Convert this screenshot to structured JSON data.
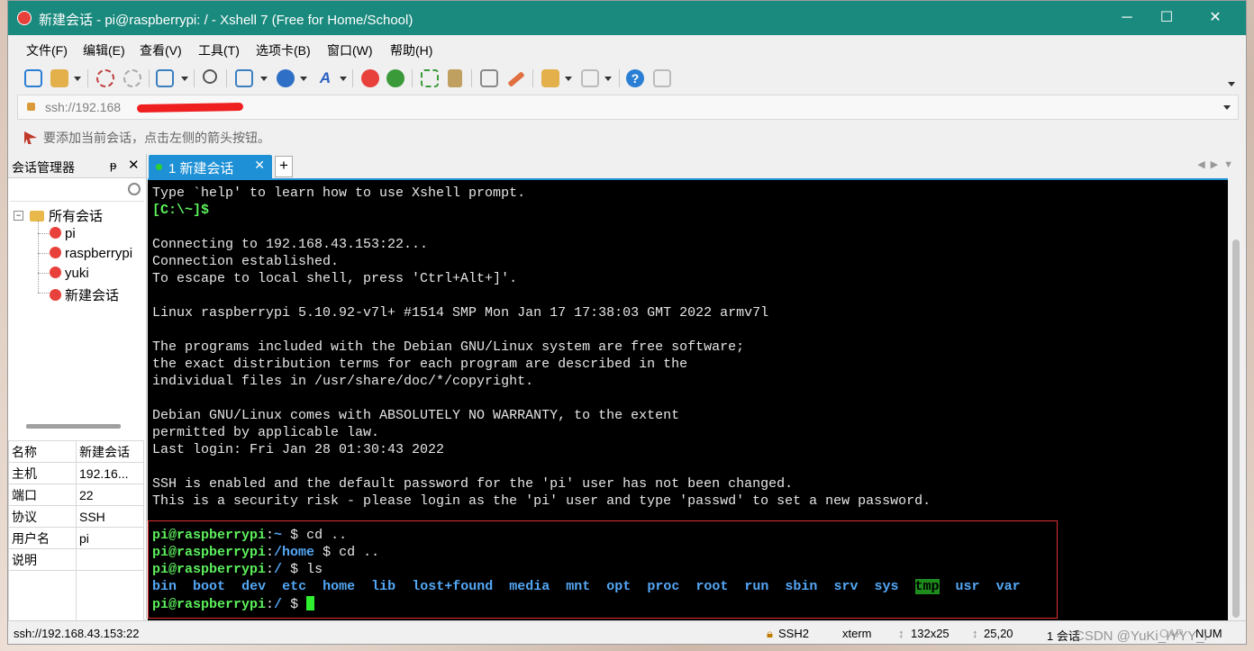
{
  "window": {
    "title": "新建会话 - pi@raspberrypi: / - Xshell 7 (Free for Home/School)"
  },
  "menu": [
    "文件(F)",
    "编辑(E)",
    "查看(V)",
    "工具(T)",
    "选项卡(B)",
    "窗口(W)",
    "帮助(H)"
  ],
  "address": {
    "url": "ssh://192.168"
  },
  "hint": "要添加当前会话，点击左侧的箭头按钮。",
  "session_manager": {
    "title": "会话管理器",
    "pin": "ᵽ",
    "close": "✕",
    "tree_root": "所有会话",
    "sessions": [
      "pi",
      "raspberrypi",
      "yuki",
      "新建会话"
    ],
    "properties": [
      {
        "key": "名称",
        "value": "新建会话"
      },
      {
        "key": "主机",
        "value": "192.16..."
      },
      {
        "key": "端口",
        "value": "22"
      },
      {
        "key": "协议",
        "value": "SSH"
      },
      {
        "key": "用户名",
        "value": "pi"
      },
      {
        "key": "说明",
        "value": ""
      }
    ]
  },
  "tab": {
    "label": "1 新建会话",
    "close": "✕",
    "add": "+"
  },
  "terminal": {
    "lines": [
      "Type `help' to learn how to use Xshell prompt.",
      "[C:\\~]$",
      "",
      "Connecting to 192.168.43.153:22...",
      "Connection established.",
      "To escape to local shell, press 'Ctrl+Alt+]'.",
      "",
      "Linux raspberrypi 5.10.92-v7l+ #1514 SMP Mon Jan 17 17:38:03 GMT 2022 armv7l",
      "",
      "The programs included with the Debian GNU/Linux system are free software;",
      "the exact distribution terms for each program are described in the",
      "individual files in /usr/share/doc/*/copyright.",
      "",
      "Debian GNU/Linux comes with ABSOLUTELY NO WARRANTY, to the extent",
      "permitted by applicable law.",
      "Last login: Fri Jan 28 01:30:43 2022",
      "",
      "SSH is enabled and the default password for the 'pi' user has not been changed.",
      "This is a security risk - please login as the 'pi' user and type 'passwd' to set a new password."
    ],
    "prompt1": {
      "user": "pi@raspberrypi",
      "path": "~",
      "cmd": " cd .."
    },
    "prompt2": {
      "user": "pi@raspberrypi",
      "path": "/home",
      "cmd": " cd .."
    },
    "prompt3": {
      "user": "pi@raspberrypi",
      "path": "/",
      "cmd": " ls"
    },
    "ls": [
      "bin",
      "boot",
      "dev",
      "etc",
      "home",
      "lib",
      "lost+found",
      "media",
      "mnt",
      "opt",
      "proc",
      "root",
      "run",
      "sbin",
      "srv",
      "sys",
      "tmp",
      "usr",
      "var"
    ],
    "prompt4": {
      "user": "pi@raspberrypi",
      "path": "/",
      "cmd": ""
    }
  },
  "status": {
    "address": "ssh://192.168.43.153:22",
    "protocol": "SSH2",
    "term": "xterm",
    "size": "132x25",
    "pos": "25,20",
    "sessions": "1 会话",
    "cap": "CAP",
    "num": "NUM",
    "watermark": "CSDN @YuKi_IYYY_i"
  }
}
